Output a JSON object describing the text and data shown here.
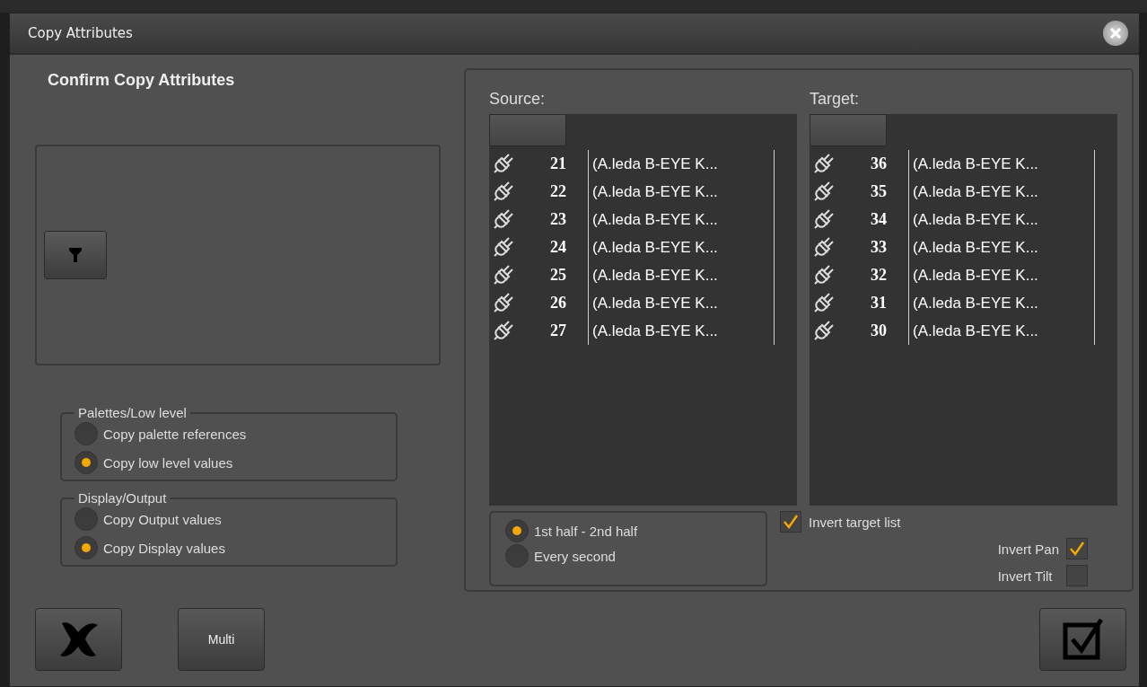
{
  "window": {
    "title": "Copy Attributes"
  },
  "heading": "Confirm Copy Attributes",
  "option_groups": [
    {
      "title": "Palettes/Low level",
      "options": [
        {
          "label": "Copy palette references",
          "selected": false
        },
        {
          "label": "Copy low level values",
          "selected": true
        }
      ]
    },
    {
      "title": "Display/Output",
      "options": [
        {
          "label": "Copy Output values",
          "selected": false
        },
        {
          "label": "Copy Display values",
          "selected": true
        }
      ]
    }
  ],
  "lists": [
    {
      "label": "Source:",
      "rows": [
        {
          "number": "21",
          "name": "(A.leda B-EYE K..."
        },
        {
          "number": "22",
          "name": "(A.leda B-EYE K..."
        },
        {
          "number": "23",
          "name": "(A.leda B-EYE K..."
        },
        {
          "number": "24",
          "name": "(A.leda B-EYE K..."
        },
        {
          "number": "25",
          "name": "(A.leda B-EYE K..."
        },
        {
          "number": "26",
          "name": "(A.leda B-EYE K..."
        },
        {
          "number": "27",
          "name": "(A.leda B-EYE K..."
        }
      ]
    },
    {
      "label": "Target:",
      "rows": [
        {
          "number": "36",
          "name": "(A.leda B-EYE K..."
        },
        {
          "number": "35",
          "name": "(A.leda B-EYE K..."
        },
        {
          "number": "34",
          "name": "(A.leda B-EYE K..."
        },
        {
          "number": "33",
          "name": "(A.leda B-EYE K..."
        },
        {
          "number": "32",
          "name": "(A.leda B-EYE K..."
        },
        {
          "number": "31",
          "name": "(A.leda B-EYE K..."
        },
        {
          "number": "30",
          "name": "(A.leda B-EYE K..."
        }
      ]
    }
  ],
  "split_mode": [
    {
      "label": "1st half - 2nd half",
      "selected": true
    },
    {
      "label": "Every second",
      "selected": false
    }
  ],
  "checkboxes": [
    {
      "kind": "box-first",
      "label": "Invert target list",
      "checked": true
    },
    {
      "kind": "label-first",
      "label": "Invert Pan",
      "checked": true
    },
    {
      "kind": "label-first",
      "label": "Invert Tilt",
      "checked": false
    }
  ],
  "multi_button": "Multi"
}
